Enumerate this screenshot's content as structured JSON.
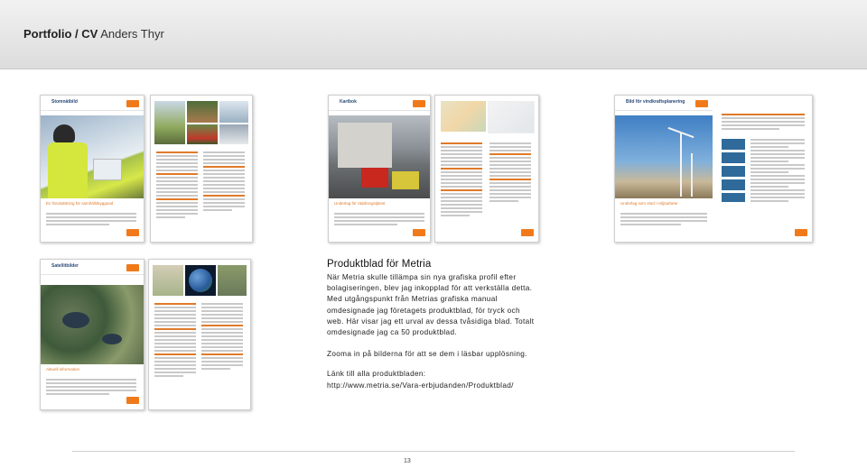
{
  "header": {
    "title_bold": "Portfolio / CV",
    "title_rest": " Anders Thyr"
  },
  "pages": {
    "p1": {
      "head": "Stomnätbild",
      "caption": "En förutsättning för samhällsbyggnad"
    },
    "p3": {
      "head": "Kartbok",
      "caption": "Underlag för räddningstjänst"
    },
    "p5": {
      "head": "Bild för vindkraftsplanering",
      "caption": "Underlag som stöd i miljöarbete"
    },
    "p6": {
      "head": "Satellitbilder",
      "caption": "Aktuell information"
    }
  },
  "description": {
    "heading": "Produktblad för Metria",
    "paragraph": "När Metria skulle tillämpa sin nya grafiska profil efter bolagiseringen, blev jag inkopplad för att verkställa detta. Med utgångspunkt från Metrias grafiska manual omdesignade jag företagets produktblad, för tryck och web. Här visar jag ett urval av dessa tvåsidiga blad. Totalt omdesignade jag ca 50 produktblad.",
    "zoom_note": "Zooma in på bilderna för att se dem i läsbar upplösning.",
    "link_label": "Länk till alla produktbladen:",
    "link_url": "http://www.metria.se/Vara-erbjudanden/Produktblad/"
  },
  "footer": {
    "page_number": "13"
  },
  "colors": {
    "accent": "#f07a1a",
    "brand_blue": "#2f6a9a"
  }
}
